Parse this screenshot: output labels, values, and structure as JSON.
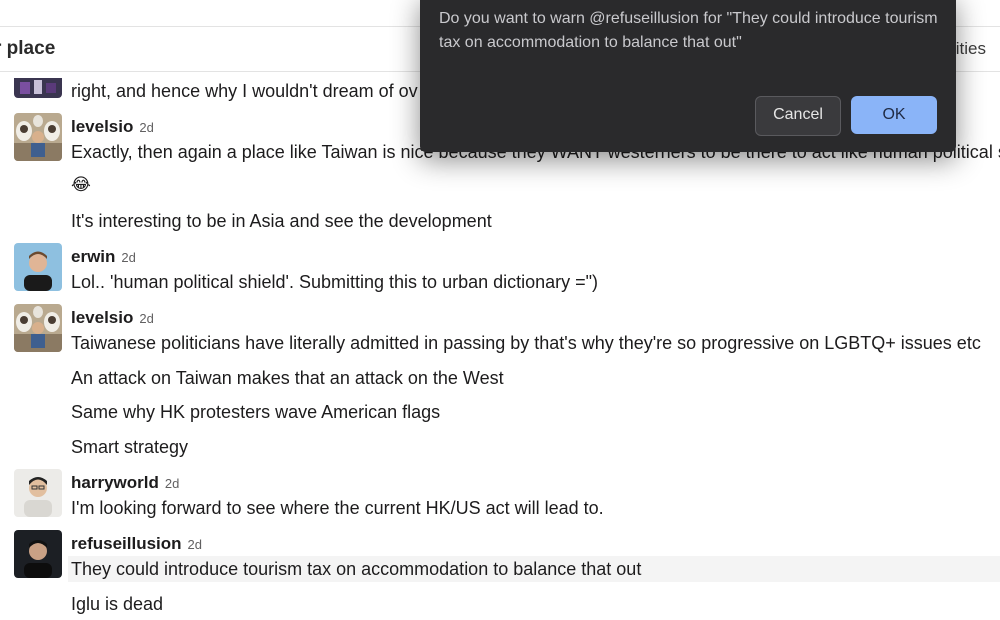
{
  "header": {
    "title": "r place",
    "right_text": "ities"
  },
  "messages": {
    "partial_line": "right, and hence why I wouldn't dream of ov",
    "groups": [
      {
        "user": "levelsio",
        "time": "2d",
        "lines": [
          "Exactly, then again a place like Taiwan is nice because they WANT westerners to be there to act like human political s",
          "😂",
          "It's interesting to be in Asia and see the development"
        ]
      },
      {
        "user": "erwin",
        "time": "2d",
        "lines": [
          "Lol.. 'human political shield'. Submitting this to urban dictionary =\")"
        ]
      },
      {
        "user": "levelsio",
        "time": "2d",
        "lines": [
          "Taiwanese politicians have literally admitted in passing by that's why they're so progressive on LGBTQ+ issues etc",
          "An attack on Taiwan makes that an attack on the West",
          "Same why HK protesters wave American flags",
          "Smart strategy"
        ]
      },
      {
        "user": "harryworld",
        "time": "2d",
        "lines": [
          "I'm looking forward to see where the current HK/US act will lead to."
        ]
      },
      {
        "user": "refuseillusion",
        "time": "2d",
        "lines": [
          "They could introduce tourism tax on accommodation to balance that out",
          "Iglu is dead"
        ]
      }
    ]
  },
  "modal": {
    "message": "Do you want to warn @refuseillusion for \"They could introduce tourism tax on accommodation to balance that out\"",
    "cancel_label": "Cancel",
    "ok_label": "OK"
  },
  "colors": {
    "modal_bg": "#2a2a2c",
    "ok_button": "#8ab4f8",
    "highlight_row": "#f4f4f4"
  }
}
